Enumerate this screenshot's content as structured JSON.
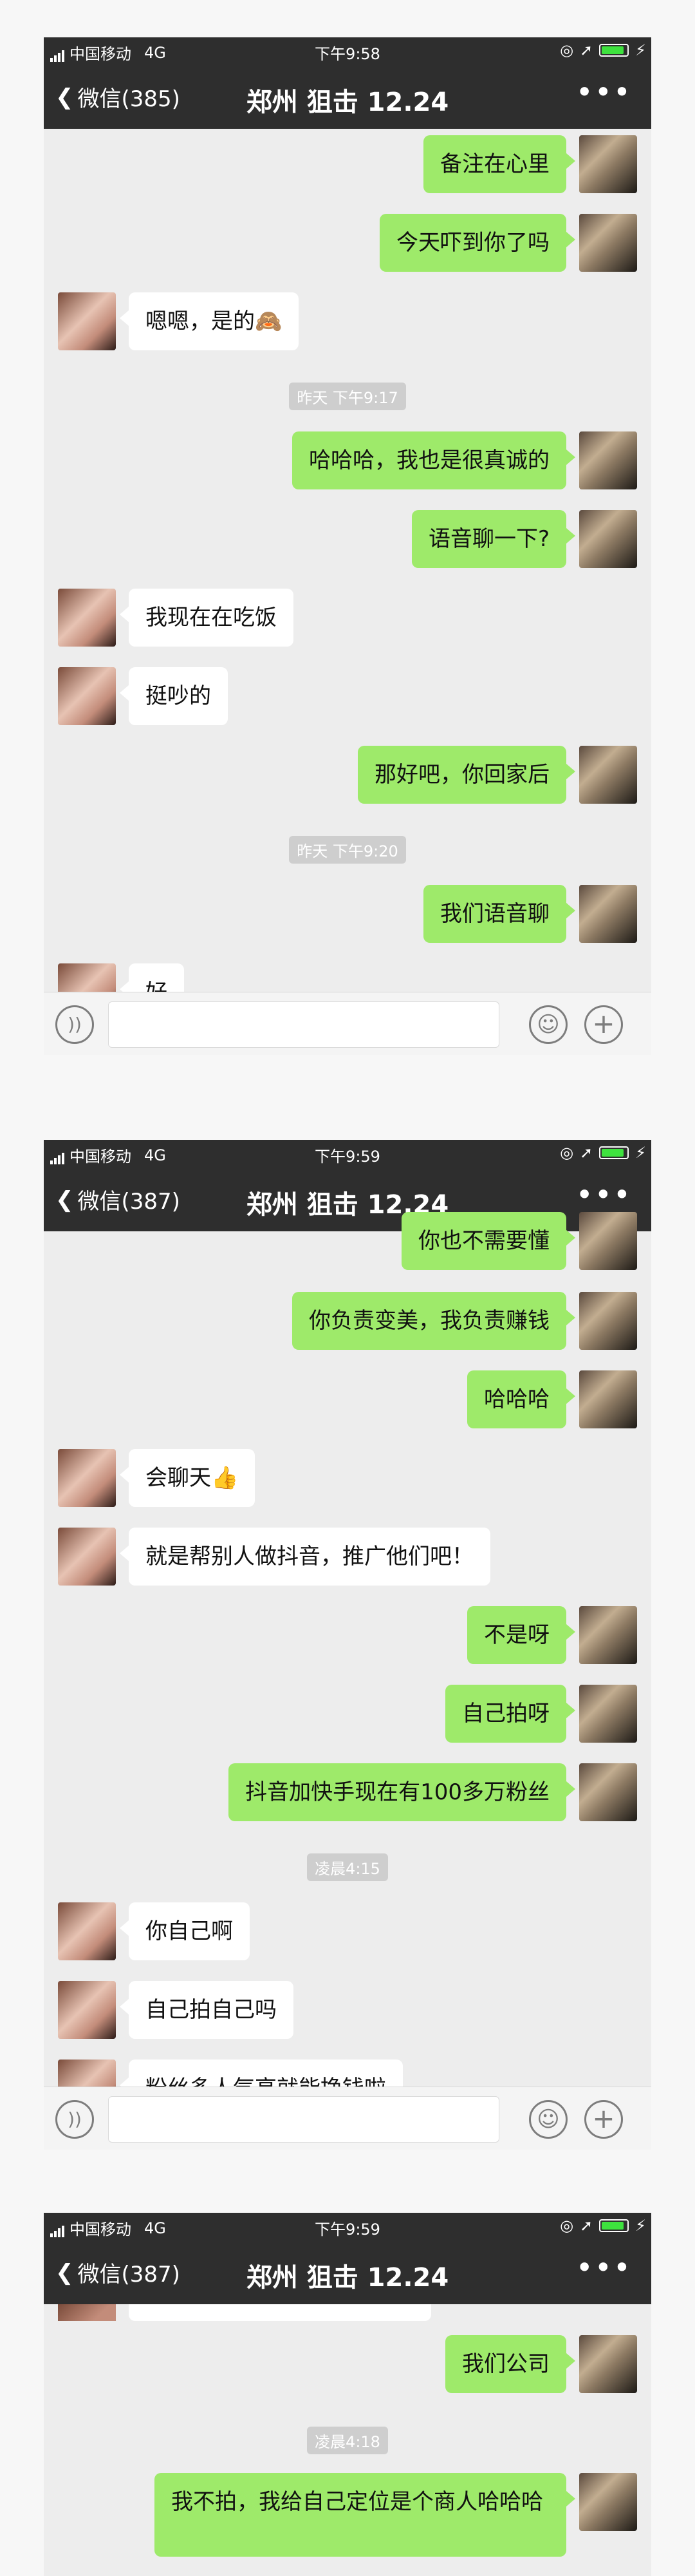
{
  "panels": [
    {
      "status": {
        "carrier": "中国移动",
        "network": "4G",
        "time": "下午9:58"
      },
      "nav": {
        "back_label": "微信(385)",
        "title": "郑州 狙击 12.24",
        "more": "•••"
      },
      "messages": [
        {
          "side": "right",
          "text": "备注在心里"
        },
        {
          "side": "right",
          "text": "今天吓到你了吗"
        },
        {
          "side": "left",
          "text": "嗯嗯，是的🙈"
        },
        {
          "side": "time",
          "text": "昨天 下午9:17"
        },
        {
          "side": "right",
          "text": "哈哈哈，我也是很真诚的"
        },
        {
          "side": "right",
          "text": "语音聊一下?"
        },
        {
          "side": "left",
          "text": "我现在在吃饭"
        },
        {
          "side": "left",
          "text": "挺吵的"
        },
        {
          "side": "right",
          "text": "那好吧，你回家后"
        },
        {
          "side": "time",
          "text": "昨天 下午9:20"
        },
        {
          "side": "right",
          "text": "我们语音聊"
        },
        {
          "side": "left",
          "text": "好"
        }
      ]
    },
    {
      "status": {
        "carrier": "中国移动",
        "network": "4G",
        "time": "下午9:59"
      },
      "nav": {
        "back_label": "微信(387)",
        "title": "郑州 狙击 12.24",
        "more": "•••"
      },
      "messages": [
        {
          "side": "right",
          "text": "你也不需要懂"
        },
        {
          "side": "right",
          "text": "你负责变美，我负责赚钱"
        },
        {
          "side": "right",
          "text": "哈哈哈"
        },
        {
          "side": "left",
          "text": "会聊天👍"
        },
        {
          "side": "left",
          "text": "就是帮别人做抖音，推广他们吧！"
        },
        {
          "side": "right",
          "text": "不是呀"
        },
        {
          "side": "right",
          "text": "自己拍呀"
        },
        {
          "side": "right",
          "text": "抖音加快手现在有100多万粉丝"
        },
        {
          "side": "time",
          "text": "凌晨4:15"
        },
        {
          "side": "left",
          "text": "你自己啊"
        },
        {
          "side": "left",
          "text": "自己拍自己吗"
        },
        {
          "side": "left",
          "text": "粉丝多人气高就能挣钱啦"
        }
      ]
    },
    {
      "status": {
        "carrier": "中国移动",
        "network": "4G",
        "time": "下午9:59"
      },
      "nav": {
        "back_label": "微信(387)",
        "title": "郑州 狙击 12.24",
        "more": "•••"
      },
      "messages": [
        {
          "side": "right",
          "text": "我们公司"
        },
        {
          "side": "time",
          "text": "凌晨4:18"
        },
        {
          "side": "right",
          "text": "我不拍，我给自己定位是个商人哈哈哈"
        }
      ]
    }
  ]
}
